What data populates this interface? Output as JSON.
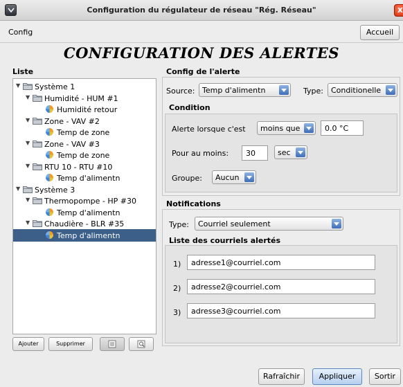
{
  "window": {
    "title": "Configuration du régulateur de réseau \"Rég. Réseau\"",
    "close_glyph": "x"
  },
  "toolbar": {
    "menu_label": "Config",
    "home_button": "Accueil"
  },
  "page_title": "CONFIGURATION DES ALERTES",
  "list": {
    "label": "Liste",
    "items": [
      {
        "label": "Système 1",
        "level": 0,
        "kind": "folder"
      },
      {
        "label": "Humidité - HUM #1",
        "level": 1,
        "kind": "folder"
      },
      {
        "label": "Humidité retour",
        "level": 2,
        "kind": "leaf"
      },
      {
        "label": "Zone - VAV #2",
        "level": 1,
        "kind": "folder"
      },
      {
        "label": "Temp de zone",
        "level": 2,
        "kind": "leaf"
      },
      {
        "label": "Zone - VAV #3",
        "level": 1,
        "kind": "folder"
      },
      {
        "label": "Temp de zone",
        "level": 2,
        "kind": "leaf"
      },
      {
        "label": "RTU 10 - RTU #10",
        "level": 1,
        "kind": "folder"
      },
      {
        "label": "Temp d'alimentn",
        "level": 2,
        "kind": "leaf"
      },
      {
        "label": "Système 3",
        "level": 0,
        "kind": "folder"
      },
      {
        "label": "Thermopompe - HP #30",
        "level": 1,
        "kind": "folder"
      },
      {
        "label": "Temp d'alimentn",
        "level": 2,
        "kind": "leaf"
      },
      {
        "label": "Chaudière - BLR #35",
        "level": 1,
        "kind": "folder"
      },
      {
        "label": "Temp d'alimentn",
        "level": 2,
        "kind": "leaf",
        "selected": true
      }
    ],
    "add_button": "Ajouter",
    "delete_button": "Supprimer"
  },
  "alert_config": {
    "label": "Config de l'alerte",
    "source_label": "Source:",
    "source_value": "Temp d'alimentn",
    "type_label": "Type:",
    "type_value": "Conditionelle",
    "condition": {
      "label": "Condition",
      "when_label": "Alerte lorsque c'est",
      "operator_value": "moins que",
      "threshold_value": "0.0 °C",
      "atleast_label": "Pour au moins:",
      "duration_value": "30",
      "unit_value": "sec",
      "group_label": "Groupe:",
      "group_value": "Aucun"
    }
  },
  "notifications": {
    "label": "Notifications",
    "type_label": "Type:",
    "type_value": "Courriel seulement",
    "emails_label": "Liste des courriels alertés",
    "emails": [
      {
        "index": "1)",
        "value": "adresse1@courriel.com"
      },
      {
        "index": "2)",
        "value": "adresse2@courriel.com"
      },
      {
        "index": "3)",
        "value": "adresse3@courriel.com"
      }
    ]
  },
  "footer": {
    "refresh_button": "Rafraîchir",
    "apply_button": "Appliquer",
    "exit_button": "Sortir"
  }
}
